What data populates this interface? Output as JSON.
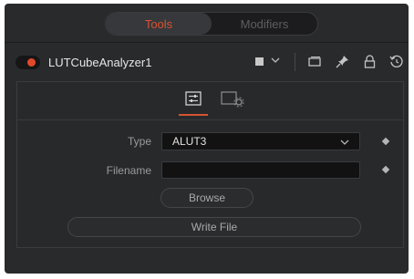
{
  "header_tabs": {
    "tools_label": "Tools",
    "modifiers_label": "Modifiers"
  },
  "tool": {
    "name": "LUTCubeAnalyzer1",
    "enabled": true,
    "accent_color": "#e2492a"
  },
  "header_icons": [
    "color-square-icon",
    "chevron-down-icon",
    "view-icon",
    "pin-icon",
    "lock-icon",
    "reset-icon"
  ],
  "content_tabs": [
    {
      "name": "controls",
      "icon": "sliders-icon",
      "active": true
    },
    {
      "name": "settings",
      "icon": "settings-icon",
      "active": false
    }
  ],
  "fields": {
    "type": {
      "label": "Type",
      "value": "ALUT3"
    },
    "filename": {
      "label": "Filename",
      "value": ""
    }
  },
  "buttons": {
    "browse": "Browse",
    "write_file": "Write File"
  },
  "colors": {
    "accent": "#d6532f",
    "panel": "#292a2c"
  }
}
